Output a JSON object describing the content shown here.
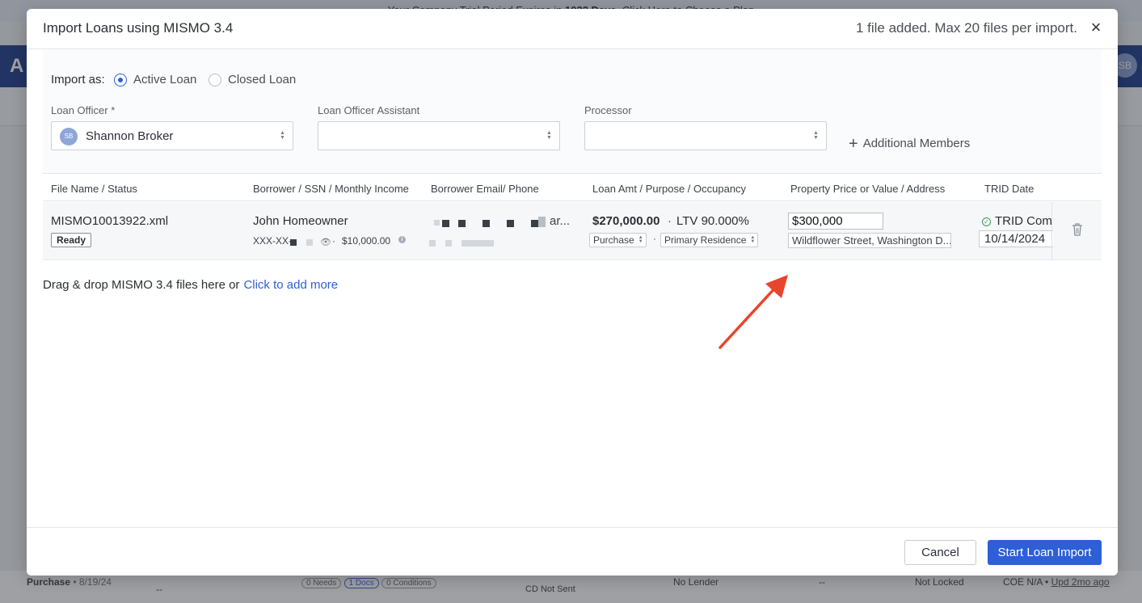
{
  "background": {
    "banner_text": "Your Company Trial Period Expires in",
    "banner_days": "1022 Days",
    "banner_link": ". Click Here to Choose a Plan",
    "logo_letter": "A",
    "avatar_initials": "SB",
    "row": {
      "type": "Purchase",
      "date": "• 8/19/24",
      "dash1": "--",
      "pill_needs": "0 Needs",
      "pill_docs": "1 Docs",
      "pill_conditions": "0 Conditions",
      "cd_status": "CD Not Sent",
      "lender": "No Lender",
      "dash2": "--",
      "lock": "Not Locked",
      "coe": "COE N/A •",
      "updated": "Upd 2mo ago"
    }
  },
  "modal": {
    "title": "Import Loans using MISMO 3.4",
    "file_count": "1 file added. Max 20 files per import.",
    "close_glyph": "×"
  },
  "import_as": {
    "label": "Import as:",
    "options": [
      {
        "label": "Active Loan",
        "selected": true
      },
      {
        "label": "Closed Loan",
        "selected": false
      }
    ]
  },
  "team": {
    "loan_officer_label": "Loan Officer *",
    "loan_officer_value": "Shannon Broker",
    "loan_officer_initials": "SB",
    "assistant_label": "Loan Officer Assistant",
    "assistant_value": "",
    "processor_label": "Processor",
    "processor_value": "",
    "additional_members": "Additional Members"
  },
  "table": {
    "headers": [
      "File Name / Status",
      "Borrower / SSN / Monthly Income",
      "Borrower Email/ Phone",
      "Loan Amt / Purpose / Occupancy",
      "Property Price or Value / Address",
      "TRID Date"
    ],
    "row": {
      "file_name": "MISMO10013922.xml",
      "status": "Ready",
      "borrower": "John Homeowner",
      "ssn_prefix": "XXX-XX-",
      "income": "$10,000.00",
      "email_suffix": "ar...",
      "loan_amount": "$270,000.00",
      "ltv": "LTV 90.000%",
      "purpose": "Purchase",
      "occupancy": "Primary Residence",
      "property_price": "$300,000",
      "address": "Wildflower Street, Washington D...",
      "trid_status": "TRID Complete",
      "trid_date": "10/14/2024"
    }
  },
  "drop_zone": {
    "text": "Drag & drop MISMO 3.4 files here or",
    "link": "Click to add more"
  },
  "footer": {
    "cancel": "Cancel",
    "start": "Start Loan Import"
  },
  "colors": {
    "accent": "#2f5fd6",
    "annotation_arrow": "#e8452c"
  }
}
